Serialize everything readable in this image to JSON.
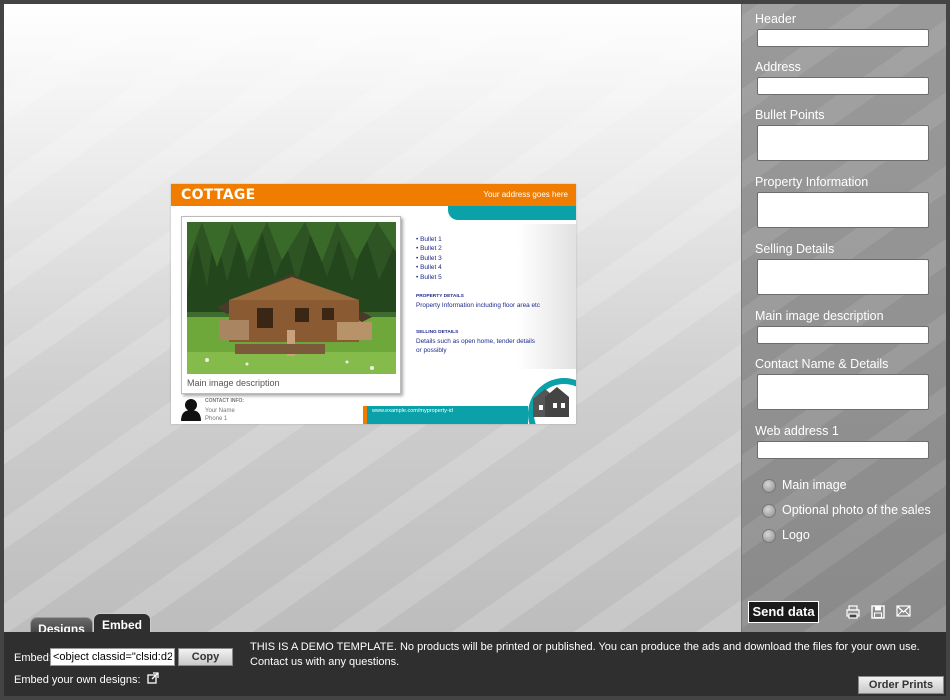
{
  "flyer": {
    "title": "COTTAGE",
    "address": "Your address goes here",
    "image_description": "Main image description",
    "bullets": [
      "• Bullet 1",
      "• Bullet 2",
      "• Bullet 3",
      "• Bullet 4",
      "• Bullet 5"
    ],
    "property_heading": "PROPERTY DETAILS",
    "property_text": "Property Information including floor area etc",
    "selling_heading": "SELLING DETAILS",
    "selling_text_1": "Details such as open home, tender details",
    "selling_text_2": "or possibly",
    "contact_heading": "CONTACT INFO:",
    "contact_name": "Your Name",
    "contact_phone": "Phone 1",
    "web": "www.example.com/myproperty-id"
  },
  "panel": {
    "fields": {
      "header": "Header",
      "address": "Address",
      "bullet_points": "Bullet Points",
      "property_information": "Property Information",
      "selling_details": "Selling Details",
      "main_image_description": "Main image description",
      "contact": "Contact Name & Details",
      "web_address": "Web address 1"
    },
    "radios": {
      "main_image": "Main image",
      "optional_photo": "Optional photo of the sales",
      "logo": "Logo"
    },
    "send_label": "Send data",
    "icons": [
      "print-icon",
      "save-icon",
      "mail-icon"
    ]
  },
  "tabs": {
    "designs": "Designs",
    "embed": "Embed",
    "active": "Embed"
  },
  "footer": {
    "embed_label": "Embed:",
    "embed_value": "<object classid=\"clsid:d2",
    "copy_label": "Copy",
    "own_designs_label": "Embed your own designs:",
    "demo_text": "THIS IS A DEMO TEMPLATE. No products will be printed or published. You can produce the ads and download the files for your own use. Contact us with any questions.",
    "order_label": "Order Prints"
  },
  "colors": {
    "flyer_orange": "#f07d00",
    "flyer_teal": "#0aa1a9",
    "flyer_text": "#1d2a8c",
    "footer_bg": "#2f2f2f"
  }
}
